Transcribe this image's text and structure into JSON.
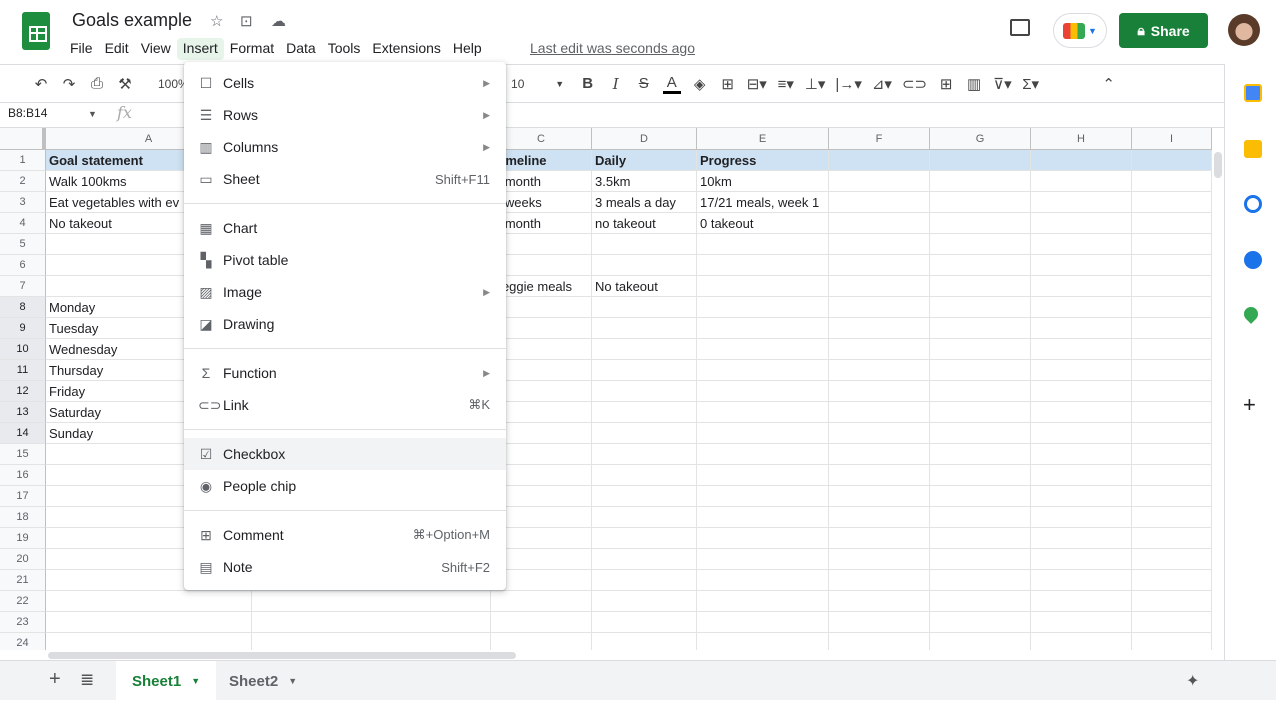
{
  "app": {
    "title": "Goals example",
    "last_edit": "Last edit was seconds ago",
    "share_label": "Share",
    "accent": "#188038"
  },
  "menubar": [
    "File",
    "Edit",
    "View",
    "Insert",
    "Format",
    "Data",
    "Tools",
    "Extensions",
    "Help"
  ],
  "active_menu": "Insert",
  "toolbar": {
    "zoom": "100%",
    "font_size": "10"
  },
  "name_box": "B8:B14",
  "fx_label": "fx",
  "columns": [
    "A",
    "B",
    "C",
    "D",
    "E",
    "F",
    "G",
    "H",
    "I"
  ],
  "rows": [
    [
      "Goal statement",
      "",
      "Timeline",
      "Daily",
      "Progress",
      "",
      "",
      "",
      ""
    ],
    [
      "Walk 100kms",
      "",
      "1 month",
      "3.5km",
      "10km",
      "",
      "",
      "",
      ""
    ],
    [
      "Eat vegetables with ev",
      "",
      "3 weeks",
      "3 meals a day",
      "17/21 meals, week 1",
      "",
      "",
      "",
      ""
    ],
    [
      "No takeout",
      "",
      "1 month",
      "no takeout",
      "0 takeout",
      "",
      "",
      "",
      ""
    ],
    [
      "",
      "",
      "",
      "",
      "",
      "",
      "",
      "",
      ""
    ],
    [
      "",
      "",
      "",
      "",
      "",
      "",
      "",
      "",
      ""
    ],
    [
      "",
      "",
      "Veggie meals",
      "No takeout",
      "",
      "",
      "",
      "",
      ""
    ],
    [
      "Monday",
      "",
      "",
      "",
      "",
      "",
      "",
      "",
      ""
    ],
    [
      "Tuesday",
      "",
      "",
      "",
      "",
      "",
      "",
      "",
      ""
    ],
    [
      "Wednesday",
      "",
      "",
      "",
      "",
      "",
      "",
      "",
      ""
    ],
    [
      "Thursday",
      "",
      "",
      "",
      "",
      "",
      "",
      "",
      ""
    ],
    [
      "Friday",
      "",
      "",
      "",
      "",
      "",
      "",
      "",
      ""
    ],
    [
      "Saturday",
      "",
      "",
      "",
      "",
      "",
      "",
      "",
      ""
    ],
    [
      "Sunday",
      "",
      "",
      "",
      "",
      "",
      "",
      "",
      ""
    ]
  ],
  "row_count": 24,
  "selected_rows": [
    8,
    9,
    10,
    11,
    12,
    13,
    14
  ],
  "insert_menu": [
    {
      "label": "Cells",
      "icon": "cells-icon",
      "glyph": "☐",
      "submenu": true
    },
    {
      "label": "Rows",
      "icon": "rows-icon",
      "glyph": "☰",
      "submenu": true
    },
    {
      "label": "Columns",
      "icon": "columns-icon",
      "glyph": "▥",
      "submenu": true
    },
    {
      "label": "Sheet",
      "icon": "sheet-icon",
      "glyph": "▭",
      "shortcut": "Shift+F11"
    },
    {
      "divider": true
    },
    {
      "label": "Chart",
      "icon": "chart-icon",
      "glyph": "▦"
    },
    {
      "label": "Pivot table",
      "icon": "pivot-table-icon",
      "glyph": "▚"
    },
    {
      "label": "Image",
      "icon": "image-icon",
      "glyph": "▨",
      "submenu": true
    },
    {
      "label": "Drawing",
      "icon": "drawing-icon",
      "glyph": "◪"
    },
    {
      "divider": true
    },
    {
      "label": "Function",
      "icon": "function-icon",
      "glyph": "Σ",
      "submenu": true
    },
    {
      "label": "Link",
      "icon": "link-icon",
      "glyph": "⊂⊃",
      "shortcut": "⌘K"
    },
    {
      "divider": true
    },
    {
      "label": "Checkbox",
      "icon": "checkbox-icon",
      "glyph": "☑",
      "highlighted": true
    },
    {
      "label": "People chip",
      "icon": "people-chip-icon",
      "glyph": "◉"
    },
    {
      "divider": true
    },
    {
      "label": "Comment",
      "icon": "comment-icon",
      "glyph": "⊞",
      "shortcut": "⌘+Option+M"
    },
    {
      "label": "Note",
      "icon": "note-icon",
      "glyph": "▤",
      "shortcut": "Shift+F2"
    }
  ],
  "sheets": [
    {
      "label": "Sheet1",
      "active": true
    },
    {
      "label": "Sheet2",
      "active": false
    }
  ]
}
